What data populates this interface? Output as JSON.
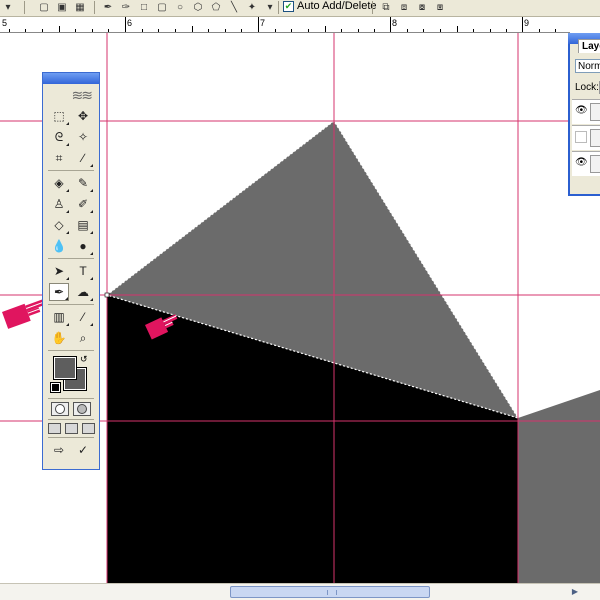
{
  "options_bar": {
    "auto_add_delete_label": "Auto Add/Delete",
    "auto_add_delete_checked": true,
    "tool_icons": [
      "pen-icon",
      "freeform-pen-icon",
      "rectangle-icon",
      "rounded-rectangle-icon",
      "ellipse-icon",
      "polygon-icon",
      "line-icon",
      "custom-shape-icon",
      "dropdown-arrow-icon"
    ],
    "path_mode_icons": [
      "add-to-area-icon",
      "subtract-icon",
      "intersect-icon",
      "exclude-icon"
    ]
  },
  "ruler": {
    "labels": [
      "5",
      "6",
      "7",
      "8",
      "9"
    ]
  },
  "canvas": {
    "guide_color": "#d6336c",
    "shape_dark_color": "#000000",
    "shape_gray_color": "#6b6b6b"
  },
  "tools_palette": {
    "rows": [
      [
        "marquee-tool-icon",
        "move-tool-icon"
      ],
      [
        "lasso-tool-icon",
        "magic-wand-tool-icon"
      ],
      [
        "crop-tool-icon",
        "slice-tool-icon"
      ],
      [
        "healing-brush-tool-icon",
        "brush-tool-icon"
      ],
      [
        "clone-stamp-tool-icon",
        "history-brush-tool-icon"
      ],
      [
        "eraser-tool-icon",
        "gradient-tool-icon"
      ],
      [
        "blur-tool-icon",
        "dodge-tool-icon"
      ],
      [
        "path-selection-tool-icon",
        "type-tool-icon"
      ],
      [
        "pen-tool-icon",
        "custom-shape-tool-icon"
      ],
      [
        "notes-tool-icon",
        "eyedropper-tool-icon"
      ],
      [
        "hand-tool-icon",
        "zoom-tool-icon"
      ]
    ],
    "active_tool": "pen-tool-icon",
    "type_tool_glyph": "T",
    "foreground_color": "#5e5e5e",
    "background_color": "#5e5e5e"
  },
  "layers_palette": {
    "tab_label": "Laye",
    "blend_mode": "Norm",
    "lock_label": "Lock:",
    "rows": [
      {
        "visible": true
      },
      {
        "visible": false
      },
      {
        "visible": true
      }
    ]
  },
  "annotations": {
    "pointer_color": "#e0155f"
  }
}
